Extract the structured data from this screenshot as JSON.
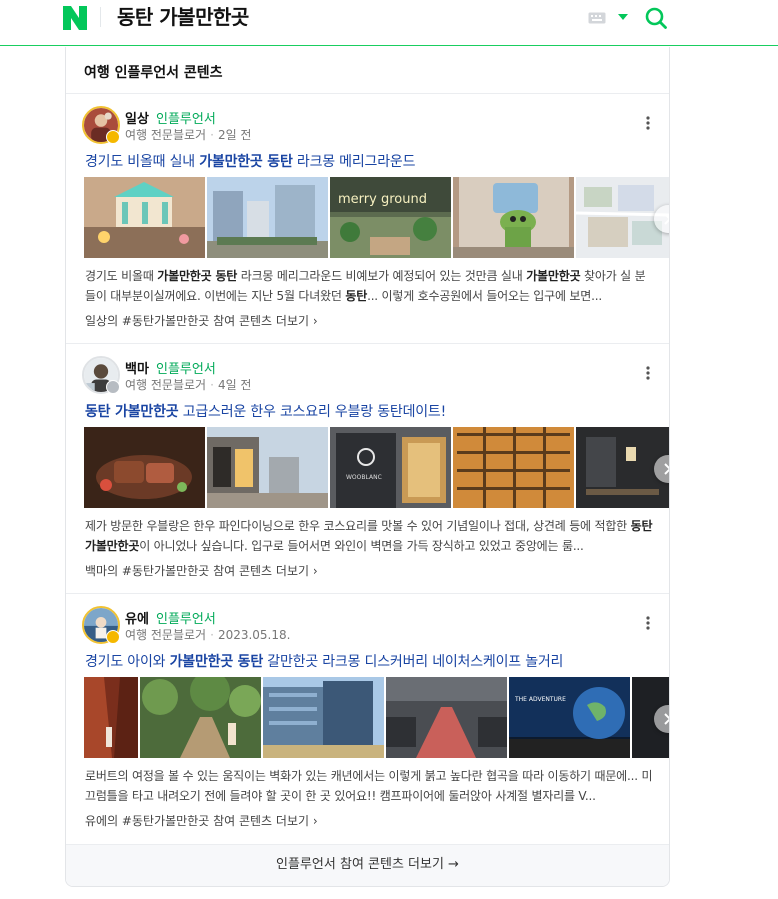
{
  "header": {
    "query": "동탄 가볼만한곳",
    "logo_icon": "naver-n-logo",
    "colors": {
      "brand": "#03c75a",
      "divider": "#19ce60"
    }
  },
  "panel": {
    "title": "여행 인플루언서 콘텐츠",
    "footer_more": "인플루언서 참여 콘텐츠 더보기 →"
  },
  "posts": [
    {
      "author": "일상",
      "role": "인플루언서",
      "category": "여행 전문블로거",
      "date": "2일 전",
      "title_parts": [
        "경기도 비올때 실내 ",
        "가볼만한곳 동탄",
        " 라크몽 메리그라운드"
      ],
      "snippet_parts": [
        "경기도 비올때 ",
        "가볼만한곳 동탄",
        " 라크몽 메리그라운드 비예보가 예정되어 있는 것만큼 실내 ",
        "가볼만한곳",
        " 찾아가 실 분들이 대부분이실꺼에요. 이번에는 지난 5월 다녀왔던 ",
        "동탄",
        "... 이렇게 호수공원에서 들어오는 입구에 보면..."
      ],
      "more_link": "일상의 #동탄가볼만한곳 참여 콘텐츠 더보기 ›",
      "images": [
        "carousel",
        "building",
        "merry-ground-sign",
        "sloth-character",
        "map"
      ],
      "image_text": {
        "sign": "merry ground"
      }
    },
    {
      "author": "백마",
      "role": "인플루언서",
      "category": "여행 전문블로거",
      "date": "4일 전",
      "title_parts": [
        "",
        "동탄 가볼만한곳",
        " 고급스러운 한우 코스요리 우블랑 동탄데이트!"
      ],
      "snippet_parts": [
        "제가 방문한 우블랑은 한우 파인다이닝으로 한우 코스요리를 맛볼 수 있어 기념일이나 접대, 상견례 등에 적합한 ",
        "동탄 가볼만한곳",
        "이 아니었나 싶습니다. 입구로 들어서면 와인이 벽면을 가득 장식하고 있었고 중앙에는 룸..."
      ],
      "more_link": "백마의 #동탄가볼만한곳 참여 콘텐츠 더보기 ›",
      "images": [
        "steak",
        "street",
        "restaurant-sign",
        "wine-wall",
        "dining-room"
      ],
      "image_text": {
        "sign": "WOOBLANC"
      }
    },
    {
      "author": "유에",
      "role": "인플루언서",
      "category": "여행 전문블로거",
      "date": "2023.05.18.",
      "title_parts": [
        "경기도 아이와 ",
        "가볼만한곳 동탄",
        " 갈만한곳 라크몽 디스커버리 네이처스케이프 놀거리"
      ],
      "snippet_parts": [
        "로버트의 여정을 볼 수 있는 움직이는 벽화가 있는 캐년에서는 이렇게 붉고 높다란 협곡을 따라 이동하기 때문에... 미끄럼틀을 타고 내려오기 전에 들려야 할 곳이 한 곳 있어요!! 캠프파이어에 둘러앉아 사계절 별자리를 V..."
      ],
      "more_link": "유에의 #동탄가볼만한곳 참여 콘텐츠 더보기 ›",
      "images": [
        "canyon",
        "forest-path",
        "glass-building",
        "parking-garage",
        "earth-screen"
      ],
      "image_text": {
        "sign": "THE ADVENTURE"
      }
    }
  ]
}
